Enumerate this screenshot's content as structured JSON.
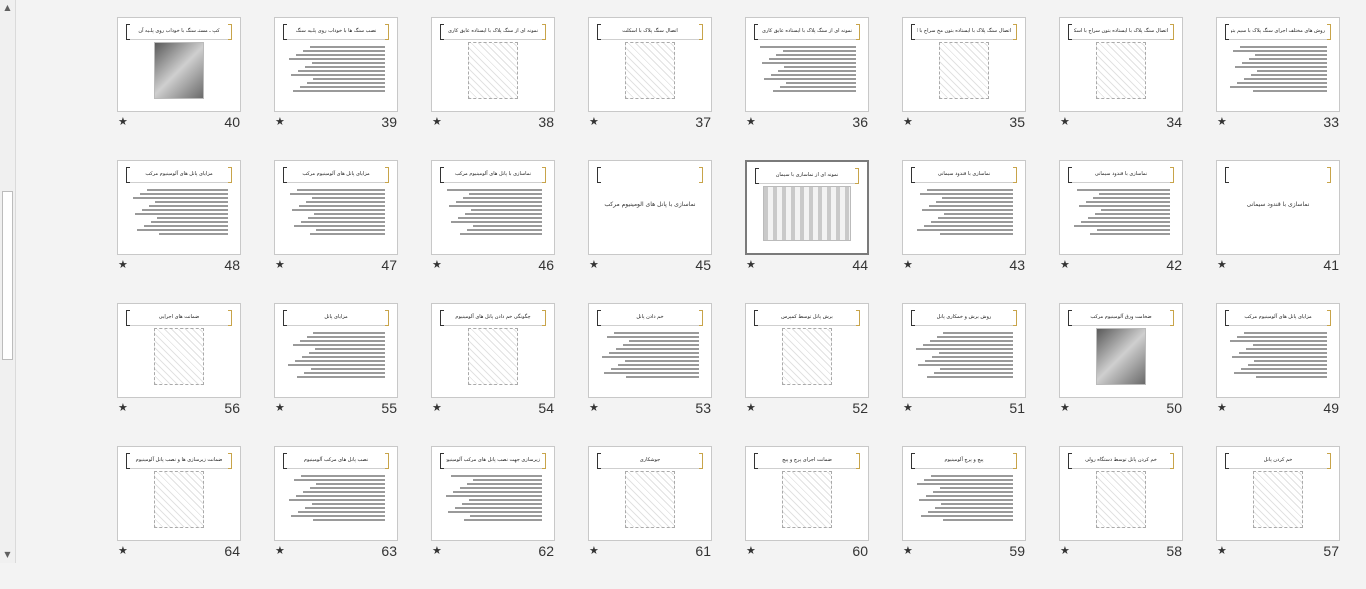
{
  "rows": [
    [
      {
        "number": "40",
        "title": "کپ ـ مستـ سنگ با خوداب روی پلـیه آن",
        "layout": "photo"
      },
      {
        "number": "39",
        "title": "نصب سنگ ها با خوداب روی پلـیه سنگ",
        "layout": "text"
      },
      {
        "number": "38",
        "title": "نمونه ای از سنگ پلاک با ایستاده عایق کاری",
        "layout": "sketch"
      },
      {
        "number": "37",
        "title": "اتصال سنگ پلاک با اسکلت",
        "layout": "sketch"
      },
      {
        "number": "36",
        "title": "نمونه ای از سنگ پلاک با ایستاده عایق کاری",
        "layout": "text"
      },
      {
        "number": "35",
        "title": "اتصال سنگ پلاک با ایستاده بتون مخ سراج با اسکلت",
        "layout": "sketch"
      },
      {
        "number": "34",
        "title": "اتصال سنگ پلاک با ایستاده بتون سراج با اسکلت",
        "layout": "sketch"
      },
      {
        "number": "33",
        "title": "روش های مختلف اجرای سنگ پلاک با سیم بتون",
        "layout": "text"
      }
    ],
    [
      {
        "number": "48",
        "title": "مزایای پانل های آلومینیوم مرکب",
        "layout": "text"
      },
      {
        "number": "47",
        "title": "مزایای پانل های آلومینیوم مرکب",
        "layout": "text"
      },
      {
        "number": "46",
        "title": "نماسازی با پانل های آلومینیوم مرکب",
        "layout": "text"
      },
      {
        "number": "45",
        "title": "",
        "center": "نماسازی با پانل های آلومینیوم مرکب",
        "layout": "center"
      },
      {
        "number": "44",
        "title": "نمونه ای از نماسازی با سیمان",
        "layout": "building",
        "selected": true
      },
      {
        "number": "43",
        "title": "نماسازی با قندود سیمانی",
        "layout": "text"
      },
      {
        "number": "42",
        "title": "نماسازی با قندود سیمانی",
        "layout": "text"
      },
      {
        "number": "41",
        "title": "",
        "center": "نماسازی با قندود سیمانی",
        "layout": "center"
      }
    ],
    [
      {
        "number": "56",
        "title": "ضمانت های اجرایی",
        "layout": "sketch"
      },
      {
        "number": "55",
        "title": "مزایای پانل",
        "layout": "text"
      },
      {
        "number": "54",
        "title": "چگونگی خم دادن پانل های آلومینیوم",
        "layout": "sketch"
      },
      {
        "number": "53",
        "title": "خم دادن پانل",
        "layout": "text"
      },
      {
        "number": "52",
        "title": "برش پانل توسط کمپرس",
        "layout": "sketch"
      },
      {
        "number": "51",
        "title": "روش برش و خمکاری پانل",
        "layout": "text"
      },
      {
        "number": "50",
        "title": "ضخامت ورق آلومینیوم مرکب",
        "layout": "photo"
      },
      {
        "number": "49",
        "title": "مزایای پانل های آلومینیوم مرکب",
        "layout": "text"
      }
    ],
    [
      {
        "number": "64",
        "title": "ضمانت زیرسازی ها و نصب پانل آلومینیوم",
        "layout": "sketch"
      },
      {
        "number": "63",
        "title": "نصب پانل های مرکب آلومینیوم",
        "layout": "text"
      },
      {
        "number": "62",
        "title": "زیرسازی جهت نصب پانل های مرکب آلومینیوم",
        "layout": "text"
      },
      {
        "number": "61",
        "title": "جوشکاری",
        "layout": "sketch"
      },
      {
        "number": "60",
        "title": "ضمانت اجرای پرچ و پیچ",
        "layout": "sketch"
      },
      {
        "number": "59",
        "title": "پیچ و پرچ آلومینیوم",
        "layout": "text"
      },
      {
        "number": "58",
        "title": "خم کردن پانل توسط دستگاه رولی",
        "layout": "sketch"
      },
      {
        "number": "57",
        "title": "خم کردن پانل",
        "layout": "sketch"
      }
    ]
  ],
  "star_glyph": "★",
  "scrollbar": {
    "up": "▲",
    "down": "▼"
  }
}
